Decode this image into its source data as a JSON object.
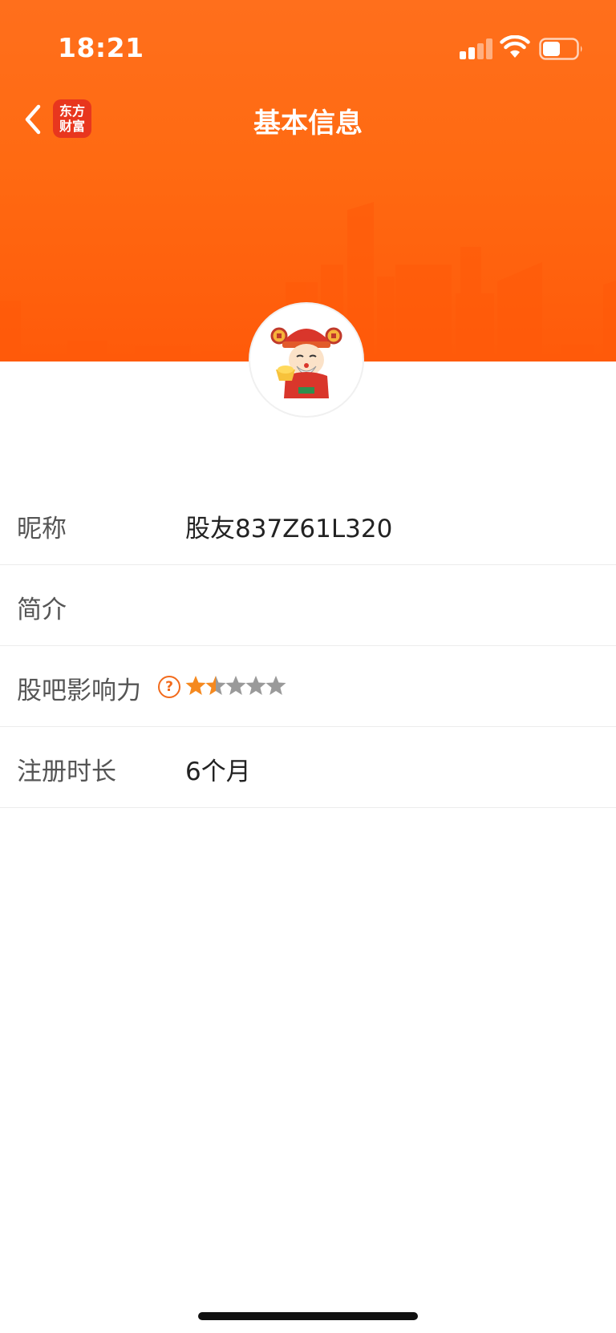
{
  "status_bar": {
    "time": "18:21",
    "signal_icon": "cellular-signal-icon",
    "wifi_icon": "wifi-icon",
    "battery_icon": "battery-icon"
  },
  "nav": {
    "back_icon": "chevron-left-icon",
    "logo_line1": "东方",
    "logo_line2": "财富",
    "title": "基本信息"
  },
  "profile": {
    "avatar_icon": "god-of-wealth-avatar"
  },
  "info_rows": {
    "nickname_label": "昵称",
    "nickname_value": "股友837Z61L320",
    "bio_label": "简介",
    "bio_value": "",
    "influence_label": "股吧影响力",
    "influence_help_glyph": "?",
    "influence_rating": 1.5,
    "influence_max": 5,
    "register_label": "注册时长",
    "register_value": "6个月"
  },
  "colors": {
    "brand_orange": "#ff6a12",
    "star_filled": "#f5891f",
    "star_empty": "#9a9a9a"
  }
}
